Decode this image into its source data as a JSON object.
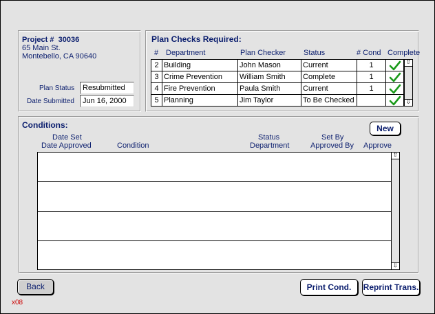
{
  "project": {
    "label": "Project #",
    "number": "30036",
    "address1": "65 Main St.",
    "address2": "Montebello, CA 90640",
    "plan_status_label": "Plan Status",
    "plan_status_value": "Resubmitted",
    "date_submitted_label": "Date Submitted",
    "date_submitted_value": "Jun 16, 2000"
  },
  "plan_checks": {
    "title": "Plan Checks Required:",
    "headers": {
      "num": "#",
      "department": "Department",
      "checker": "Plan Checker",
      "status": "Status",
      "cond": "# Cond",
      "complete": "Complete"
    },
    "rows": [
      {
        "num": "2",
        "department": "Building",
        "checker": "John Mason",
        "status": "Current",
        "cond": "1",
        "complete": true
      },
      {
        "num": "3",
        "department": "Crime Prevention",
        "checker": "William Smith",
        "status": "Complete",
        "cond": "1",
        "complete": true
      },
      {
        "num": "4",
        "department": "Fire Prevention",
        "checker": "Paula Smith",
        "status": "Current",
        "cond": "1",
        "complete": true
      },
      {
        "num": "5",
        "department": "Planning",
        "checker": "Jim Taylor",
        "status": "To Be Checked",
        "cond": "",
        "complete": true
      }
    ]
  },
  "conditions": {
    "title": "Conditions:",
    "new_label": "New",
    "headers": {
      "date_set": "Date Set",
      "date_approved": "Date Approved",
      "condition": "Condition",
      "status": "Status",
      "department": "Department",
      "set_by": "Set By",
      "approved_by": "Approved By",
      "approve": "Approve"
    }
  },
  "footer": {
    "back_label": "Back",
    "print_label": "Print Cond.",
    "reprint_label": "Reprint Trans.",
    "screen_code": "x08"
  },
  "colors": {
    "accent_text": "#0b1e6e",
    "check_green": "#1a9a1a",
    "screen_code": "#cc0000"
  },
  "icons": {
    "check": "check-icon",
    "scroll_up": "scroll-up-arrow-icon",
    "scroll_down": "scroll-down-arrow-icon"
  }
}
